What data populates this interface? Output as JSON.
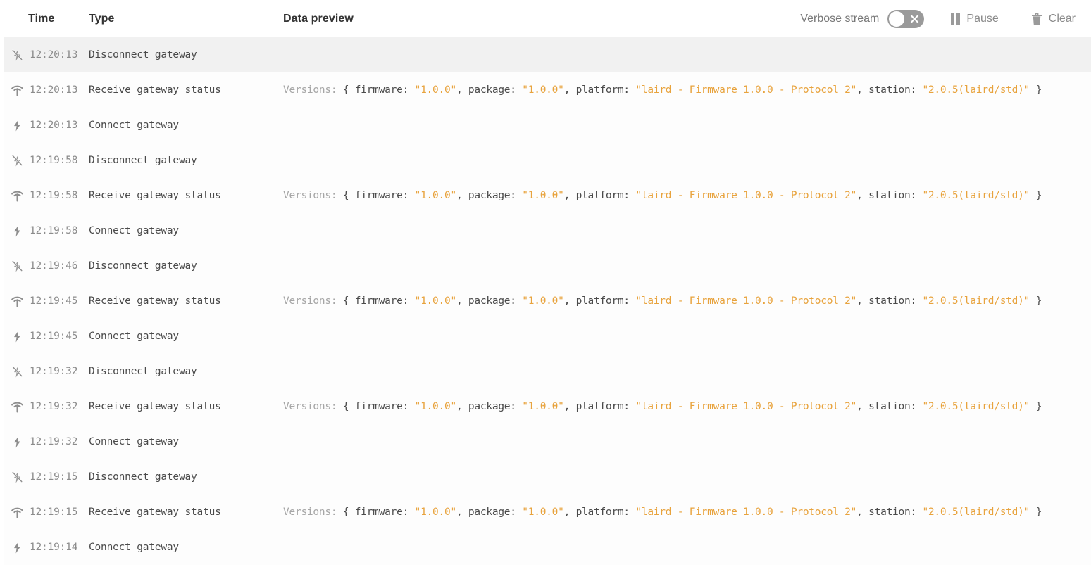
{
  "header": {
    "columns": {
      "time": "Time",
      "type": "Type",
      "data_preview": "Data preview"
    },
    "verbose_stream_label": "Verbose stream",
    "verbose_stream_enabled": false,
    "pause_label": "Pause",
    "clear_label": "Clear"
  },
  "colors": {
    "string_value": "#e8a33d",
    "key_text": "#4a4a4a",
    "muted_text": "#8c8c8c",
    "row_highlight": "#f1f1f1",
    "toggle_track": "#9a9a9a"
  },
  "data_preview_template": {
    "label": "Versions:",
    "open_brace": "{",
    "close_brace": "}",
    "fields": [
      {
        "key": "firmware:",
        "value": "\"1.0.0\"",
        "comma": ","
      },
      {
        "key": "package:",
        "value": "\"1.0.0\"",
        "comma": ","
      },
      {
        "key": "platform:",
        "value": "\"laird - Firmware 1.0.0 - Protocol 2\"",
        "comma": ","
      },
      {
        "key": "station:",
        "value": "\"2.0.5(laird/std)\"",
        "comma": ""
      }
    ]
  },
  "rows": [
    {
      "time": "12:20:13",
      "type": "Disconnect gateway",
      "icon": "flash-off-icon",
      "has_data": false,
      "highlight": true
    },
    {
      "time": "12:20:13",
      "type": "Receive gateway status",
      "icon": "wifi-icon",
      "has_data": true,
      "highlight": false
    },
    {
      "time": "12:20:13",
      "type": "Connect gateway",
      "icon": "flash-on-icon",
      "has_data": false,
      "highlight": false
    },
    {
      "time": "12:19:58",
      "type": "Disconnect gateway",
      "icon": "flash-off-icon",
      "has_data": false,
      "highlight": false
    },
    {
      "time": "12:19:58",
      "type": "Receive gateway status",
      "icon": "wifi-icon",
      "has_data": true,
      "highlight": false
    },
    {
      "time": "12:19:58",
      "type": "Connect gateway",
      "icon": "flash-on-icon",
      "has_data": false,
      "highlight": false
    },
    {
      "time": "12:19:46",
      "type": "Disconnect gateway",
      "icon": "flash-off-icon",
      "has_data": false,
      "highlight": false
    },
    {
      "time": "12:19:45",
      "type": "Receive gateway status",
      "icon": "wifi-icon",
      "has_data": true,
      "highlight": false
    },
    {
      "time": "12:19:45",
      "type": "Connect gateway",
      "icon": "flash-on-icon",
      "has_data": false,
      "highlight": false
    },
    {
      "time": "12:19:32",
      "type": "Disconnect gateway",
      "icon": "flash-off-icon",
      "has_data": false,
      "highlight": false
    },
    {
      "time": "12:19:32",
      "type": "Receive gateway status",
      "icon": "wifi-icon",
      "has_data": true,
      "highlight": false
    },
    {
      "time": "12:19:32",
      "type": "Connect gateway",
      "icon": "flash-on-icon",
      "has_data": false,
      "highlight": false
    },
    {
      "time": "12:19:15",
      "type": "Disconnect gateway",
      "icon": "flash-off-icon",
      "has_data": false,
      "highlight": false
    },
    {
      "time": "12:19:15",
      "type": "Receive gateway status",
      "icon": "wifi-icon",
      "has_data": true,
      "highlight": false
    },
    {
      "time": "12:19:14",
      "type": "Connect gateway",
      "icon": "flash-on-icon",
      "has_data": false,
      "highlight": false
    }
  ]
}
